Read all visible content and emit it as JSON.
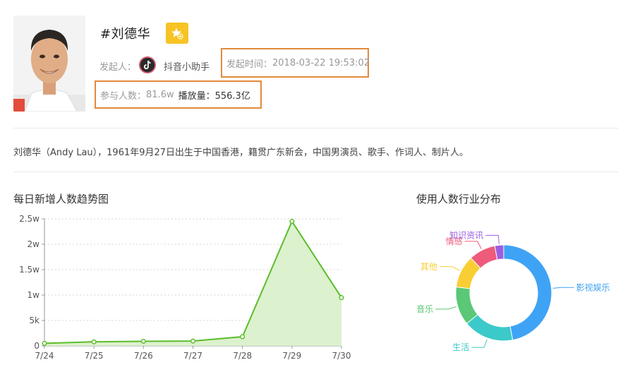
{
  "topic": {
    "title": "#刘德华",
    "initiator_label": "发起人：",
    "initiator_name": "抖音小助手",
    "start_time_label": "发起时间：",
    "start_time": "2018-03-22 19:53:02",
    "participants_label": "参与人数：",
    "participants": "81.6w",
    "plays_label": "播放量：",
    "plays": "556.3亿",
    "description": "刘德华（Andy Lau），1961年9月27日出生于中国香港，籍贯广东新会，中国男演员、歌手、作词人、制片人。"
  },
  "icons": {
    "favorite": "star-plus-icon",
    "assistant": "tiktok-logo-icon",
    "avatar": "portrait-photo"
  },
  "colors": {
    "highlight_box": "#e28a3c",
    "favorite_button": "#f7c325",
    "line": "#5bbd2b",
    "area": "#d8f0c8"
  },
  "trend_chart": {
    "title": "每日新增人数趋势图",
    "chart_data": {
      "type": "area",
      "x": [
        "7/24",
        "7/25",
        "7/26",
        "7/27",
        "7/28",
        "7/29",
        "7/30"
      ],
      "values": [
        500,
        800,
        900,
        950,
        1800,
        24500,
        9500
      ],
      "ylim": [
        0,
        25000
      ],
      "yticks": [
        {
          "value": 0,
          "label": "0"
        },
        {
          "value": 5000,
          "label": "5k"
        },
        {
          "value": 10000,
          "label": "1w"
        },
        {
          "value": 15000,
          "label": "1.5w"
        },
        {
          "value": 20000,
          "label": "2w"
        },
        {
          "value": 25000,
          "label": "2.5w"
        }
      ],
      "grid": true
    }
  },
  "industry_chart": {
    "title": "使用人数行业分布",
    "chart_data": {
      "type": "pie",
      "donut": true,
      "slices": [
        {
          "label": "影视娱乐",
          "value": 47,
          "color": "#3fa3f5"
        },
        {
          "label": "生活",
          "value": 17,
          "color": "#3cc9c9"
        },
        {
          "label": "音乐",
          "value": 13,
          "color": "#5ac876"
        },
        {
          "label": "其他",
          "value": 11,
          "color": "#f9ce35"
        },
        {
          "label": "情感",
          "value": 9,
          "color": "#ef5b7b"
        },
        {
          "label": "知识资讯",
          "value": 3,
          "color": "#9b5ee0"
        }
      ]
    }
  }
}
